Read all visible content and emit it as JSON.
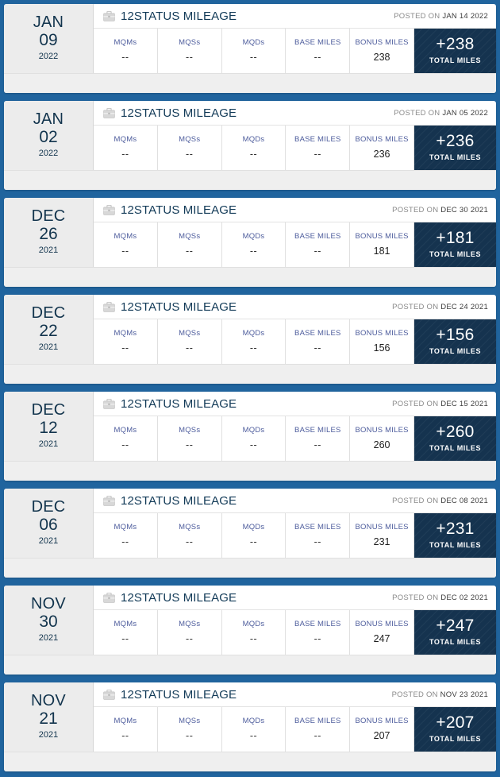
{
  "theme": {
    "page_background": "#20649e",
    "card_background": "#ffffff",
    "date_column_background": "#ececec",
    "total_box_background": "#15334f",
    "stat_label_color": "#4d5c9c",
    "title_color": "#123a57",
    "footer_background": "#efefef"
  },
  "labels": {
    "activity_title": "12STATUS MILEAGE",
    "posted_on_prefix": "POSTED ON",
    "total_miles_label": "TOTAL MILES",
    "briefcase_icon_name": "briefcase-icon",
    "stat_labels": [
      "MQMs",
      "MQSs",
      "MQDs",
      "BASE MILES",
      "BONUS MILES"
    ],
    "empty_value": "--"
  },
  "activities": [
    {
      "date": {
        "month": "JAN",
        "day": "09",
        "year": "2022"
      },
      "title": "12STATUS MILEAGE",
      "posted_on": "JAN 14 2022",
      "stats": {
        "mqms": "--",
        "mqss": "--",
        "mqds": "--",
        "base_miles": "--",
        "bonus_miles": "238"
      },
      "total_miles": "+238"
    },
    {
      "date": {
        "month": "JAN",
        "day": "02",
        "year": "2022"
      },
      "title": "12STATUS MILEAGE",
      "posted_on": "JAN 05 2022",
      "stats": {
        "mqms": "--",
        "mqss": "--",
        "mqds": "--",
        "base_miles": "--",
        "bonus_miles": "236"
      },
      "total_miles": "+236"
    },
    {
      "date": {
        "month": "DEC",
        "day": "26",
        "year": "2021"
      },
      "title": "12STATUS MILEAGE",
      "posted_on": "DEC 30 2021",
      "stats": {
        "mqms": "--",
        "mqss": "--",
        "mqds": "--",
        "base_miles": "--",
        "bonus_miles": "181"
      },
      "total_miles": "+181"
    },
    {
      "date": {
        "month": "DEC",
        "day": "22",
        "year": "2021"
      },
      "title": "12STATUS MILEAGE",
      "posted_on": "DEC 24 2021",
      "stats": {
        "mqms": "--",
        "mqss": "--",
        "mqds": "--",
        "base_miles": "--",
        "bonus_miles": "156"
      },
      "total_miles": "+156"
    },
    {
      "date": {
        "month": "DEC",
        "day": "12",
        "year": "2021"
      },
      "title": "12STATUS MILEAGE",
      "posted_on": "DEC 15 2021",
      "stats": {
        "mqms": "--",
        "mqss": "--",
        "mqds": "--",
        "base_miles": "--",
        "bonus_miles": "260"
      },
      "total_miles": "+260"
    },
    {
      "date": {
        "month": "DEC",
        "day": "06",
        "year": "2021"
      },
      "title": "12STATUS MILEAGE",
      "posted_on": "DEC 08 2021",
      "stats": {
        "mqms": "--",
        "mqss": "--",
        "mqds": "--",
        "base_miles": "--",
        "bonus_miles": "231"
      },
      "total_miles": "+231"
    },
    {
      "date": {
        "month": "NOV",
        "day": "30",
        "year": "2021"
      },
      "title": "12STATUS MILEAGE",
      "posted_on": "DEC 02 2021",
      "stats": {
        "mqms": "--",
        "mqss": "--",
        "mqds": "--",
        "base_miles": "--",
        "bonus_miles": "247"
      },
      "total_miles": "+247"
    },
    {
      "date": {
        "month": "NOV",
        "day": "21",
        "year": "2021"
      },
      "title": "12STATUS MILEAGE",
      "posted_on": "NOV 23 2021",
      "stats": {
        "mqms": "--",
        "mqss": "--",
        "mqds": "--",
        "base_miles": "--",
        "bonus_miles": "207"
      },
      "total_miles": "+207"
    }
  ]
}
